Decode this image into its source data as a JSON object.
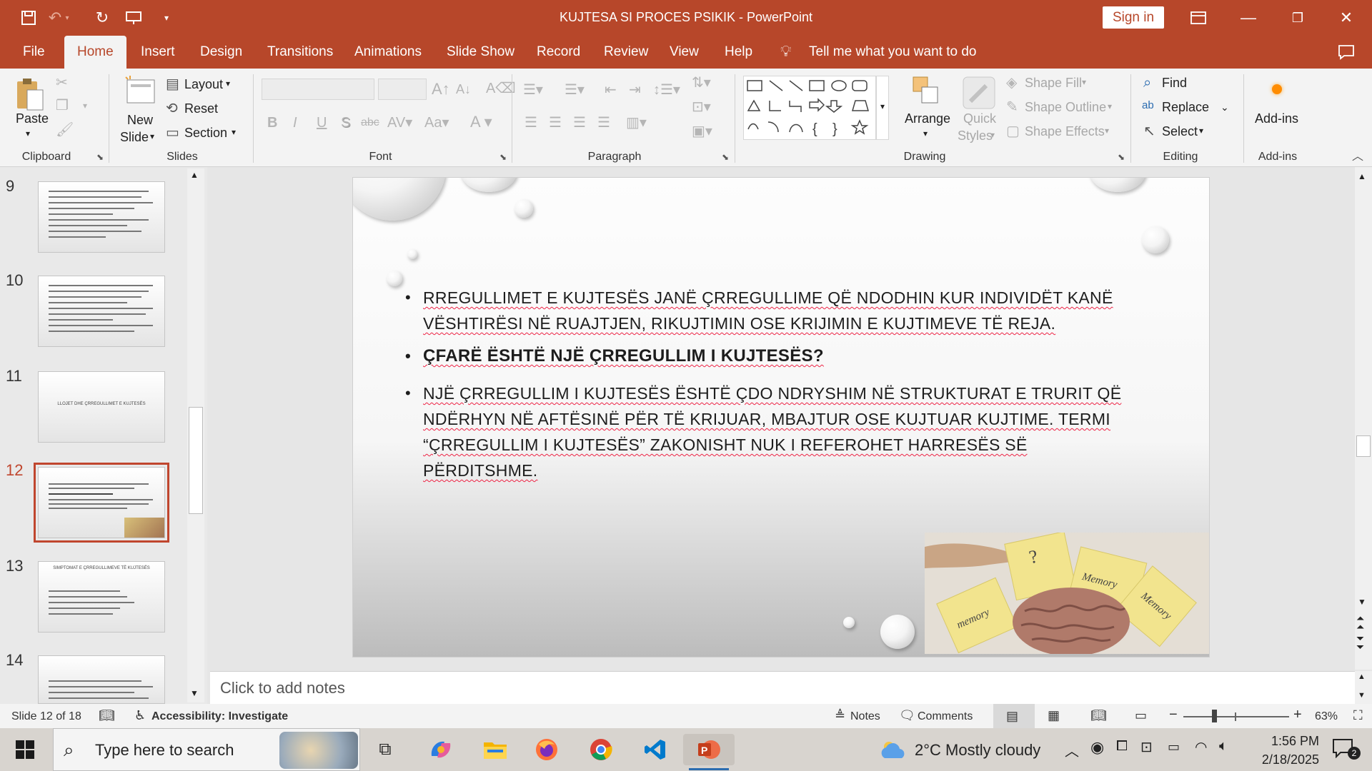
{
  "window": {
    "title": "KUJTESA SI PROCES PSIKIK  -  PowerPoint",
    "sign_in": "Sign in"
  },
  "tabs": [
    "File",
    "Home",
    "Insert",
    "Design",
    "Transitions",
    "Animations",
    "Slide Show",
    "Record",
    "Review",
    "View",
    "Help"
  ],
  "tell_me": "Tell me what you want to do",
  "ribbon": {
    "clipboard": {
      "paste": "Paste",
      "group": "Clipboard"
    },
    "slides": {
      "new_slide_1": "New",
      "new_slide_2": "Slide",
      "layout": "Layout",
      "reset": "Reset",
      "section": "Section",
      "group": "Slides"
    },
    "font": {
      "group": "Font",
      "bold": "B",
      "italic": "I",
      "underline": "U",
      "strike": "S"
    },
    "paragraph": {
      "group": "Paragraph"
    },
    "drawing": {
      "arrange": "Arrange",
      "quick_styles_1": "Quick",
      "quick_styles_2": "Styles",
      "shape_fill": "Shape Fill",
      "shape_outline": "Shape Outline",
      "shape_effects": "Shape Effects",
      "group": "Drawing"
    },
    "editing": {
      "find": "Find",
      "replace": "Replace",
      "select": "Select",
      "group": "Editing"
    },
    "addins": {
      "label": "Add-ins",
      "group": "Add-ins"
    }
  },
  "thumbnails": [
    {
      "num": "9",
      "selected": false
    },
    {
      "num": "10",
      "selected": false
    },
    {
      "num": "11",
      "selected": false,
      "title": "LLOJET DHE ÇRREGULLIMET E KUJTESËS"
    },
    {
      "num": "12",
      "selected": true
    },
    {
      "num": "13",
      "selected": false,
      "title": "SIMPTOMAT E ÇRREGULLIMEVE TË KUJTESËS"
    },
    {
      "num": "14",
      "selected": false
    }
  ],
  "slide": {
    "bullet1": "RREGULLIMET E KUJTESËS JANË ÇRREGULLIME QË NDODHIN KUR INDIVIDËT KANË VËSHTIRËSI NË RUAJTJEN, RIKUJTIMIN OSE KRIJIMIN E KUJTIMEVE TË REJA.",
    "bullet2": "ÇFARË ËSHTË NJË ÇRREGULLIM I KUJTESËS?",
    "bullet3": "NJË ÇRREGULLIM I KUJTESËS ËSHTË ÇDO NDRYSHIM NË STRUKTURAT E TRURIT QË NDËRHYN NË AFTËSINË PËR TË KRIJUAR, MBAJTUR OSE KUJTUAR KUJTIME. TERMI “ÇRREGULLIM I KUJTESËS” ZAKONISHT NUK I REFEROHET HARRESËS SË PËRDITSHME."
  },
  "notes_placeholder": "Click to add notes",
  "status": {
    "slide_count": "Slide 12 of 18",
    "accessibility": "Accessibility: Investigate",
    "notes": "Notes",
    "comments": "Comments",
    "zoom": "63%"
  },
  "taskbar": {
    "search_placeholder": "Type here to search",
    "weather": "2°C  Mostly cloudy",
    "time": "1:56 PM",
    "date": "2/18/2025",
    "notif_count": "2"
  },
  "colors": {
    "accent": "#b7472a",
    "selection": "#c0462e"
  }
}
